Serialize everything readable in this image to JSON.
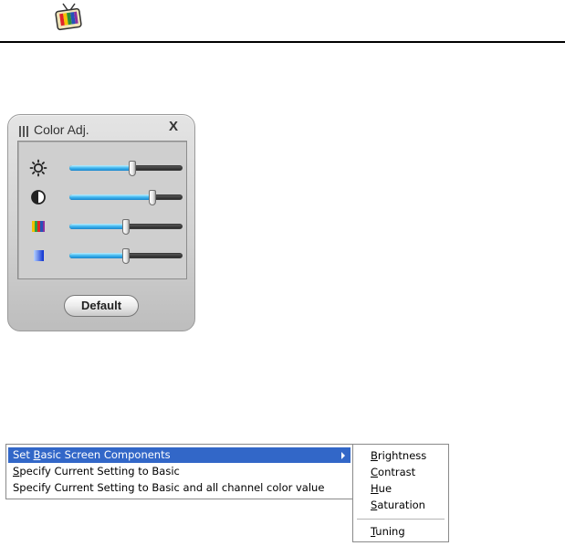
{
  "color_adj_panel": {
    "title": "Color Adj.",
    "close_label": "X",
    "default_button": "Default",
    "sliders": [
      {
        "name": "brightness",
        "icon": "sun-icon",
        "level": 0.56
      },
      {
        "name": "contrast",
        "icon": "half-circle-icon",
        "level": 0.73
      },
      {
        "name": "hue",
        "icon": "color-bars-icon",
        "level": 0.5
      },
      {
        "name": "saturation",
        "icon": "blue-gradient-icon",
        "level": 0.5
      }
    ]
  },
  "context_menu": {
    "items": [
      {
        "pre": "Set ",
        "key": "B",
        "post": "asic Screen Components",
        "selected": true,
        "has_submenu": true
      },
      {
        "pre": "",
        "key": "S",
        "post": "pecify Current Setting to Basic",
        "selected": false,
        "has_submenu": false
      },
      {
        "pre": "Specify Current Setting to Basic and all channel color value",
        "key": "",
        "post": "",
        "selected": false,
        "has_submenu": false
      }
    ]
  },
  "submenu": {
    "items": [
      {
        "key": "B",
        "rest": "rightness"
      },
      {
        "key": "C",
        "rest": "ontrast"
      },
      {
        "key": "H",
        "rest": "ue"
      },
      {
        "key": "S",
        "rest": "aturation"
      }
    ],
    "tuning": {
      "key": "T",
      "rest": "uning"
    }
  },
  "colors": {
    "menu_highlight": "#3267c8",
    "slider_fill": "#3fb6ef",
    "slider_track": "#2b2b2b"
  }
}
